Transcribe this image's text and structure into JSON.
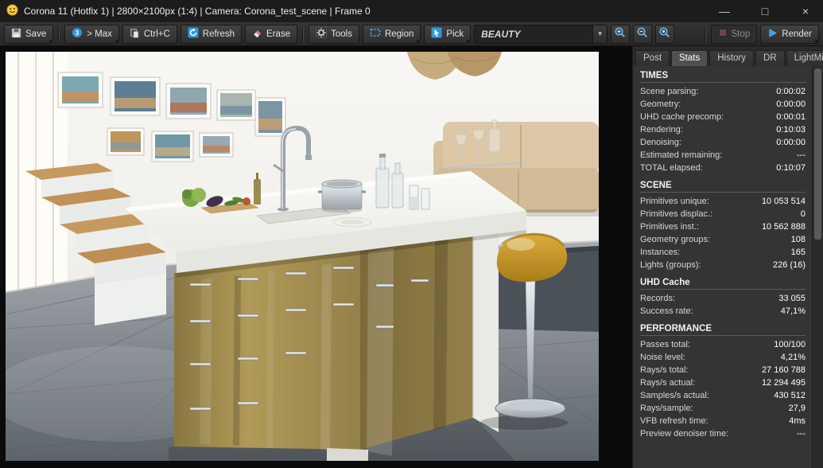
{
  "window": {
    "title": "Corona 11 (Hotfix 1) | 2800×2100px (1:4) | Camera: Corona_test_scene | Frame 0",
    "controls": {
      "minimize": "—",
      "maximize": "□",
      "close": "×"
    }
  },
  "toolbar": {
    "save": "Save",
    "max": "> Max",
    "copy": "Ctrl+C",
    "refresh": "Refresh",
    "erase": "Erase",
    "tools": "Tools",
    "region": "Region",
    "pick": "Pick",
    "channel": "BEAUTY",
    "stop": "Stop",
    "render": "Render"
  },
  "tabs": [
    {
      "label": "Post"
    },
    {
      "label": "Stats"
    },
    {
      "label": "History"
    },
    {
      "label": "DR"
    },
    {
      "label": "LightMix"
    }
  ],
  "active_tab": "Stats",
  "stats": {
    "sections": [
      {
        "title": "TIMES",
        "rows": [
          {
            "label": "Scene parsing:",
            "value": "0:00:02"
          },
          {
            "label": "Geometry:",
            "value": "0:00:00"
          },
          {
            "label": "UHD cache precomp:",
            "value": "0:00:01"
          },
          {
            "label": "Rendering:",
            "value": "0:10:03"
          },
          {
            "label": "Denoising:",
            "value": "0:00:00"
          },
          {
            "label": "Estimated remaining:",
            "value": "---"
          },
          {
            "label": "TOTAL elapsed:",
            "value": "0:10:07"
          }
        ]
      },
      {
        "title": "SCENE",
        "rows": [
          {
            "label": "Primitives unique:",
            "value": "10 053 514"
          },
          {
            "label": "Primitives displac.:",
            "value": "0"
          },
          {
            "label": "Primitives inst.:",
            "value": "10 562 888"
          },
          {
            "label": "Geometry groups:",
            "value": "108"
          },
          {
            "label": "Instances:",
            "value": "165"
          },
          {
            "label": "Lights (groups):",
            "value": "226 (16)"
          }
        ]
      },
      {
        "title": "UHD Cache",
        "rows": [
          {
            "label": "Records:",
            "value": "33 055"
          },
          {
            "label": "Success rate:",
            "value": "47,1%"
          }
        ]
      },
      {
        "title": "PERFORMANCE",
        "rows": [
          {
            "label": "Passes total:",
            "value": "100/100"
          },
          {
            "label": "Noise level:",
            "value": "4,21%"
          },
          {
            "label": "Rays/s total:",
            "value": "27 160 788"
          },
          {
            "label": "Rays/s actual:",
            "value": "12 294 495"
          },
          {
            "label": "Samples/s actual:",
            "value": "430 512"
          },
          {
            "label": "Rays/sample:",
            "value": "27,9"
          },
          {
            "label": "VFB refresh time:",
            "value": "4ms"
          },
          {
            "label": "Preview denoiser time:",
            "value": "---"
          }
        ]
      }
    ]
  },
  "icons": {
    "app": "smiley-icon",
    "save": "floppy-disk-icon",
    "max": "3dsmax-logo-icon",
    "copy": "copy-pages-icon",
    "refresh": "circular-arrow-icon",
    "erase": "eraser-icon",
    "tools": "gear-icon",
    "region": "dashed-rectangle-icon",
    "pick": "picker-cursor-icon",
    "zoom_in": "magnifier-plus-icon",
    "zoom_out": "magnifier-minus-icon",
    "zoom_reset": "magnifier-reset-icon",
    "stop": "stop-square-icon",
    "render": "play-triangle-icon"
  },
  "colors": {
    "accent_blue": "#2f9fe0",
    "titlebar": "#1c1c1c",
    "toolbar": "#2d2d2d",
    "panel": "#343434",
    "tab_active": "#505050",
    "text": "#e6e6e6",
    "island_gold": "#9d8a50",
    "stool_gold": "#c9992c"
  }
}
